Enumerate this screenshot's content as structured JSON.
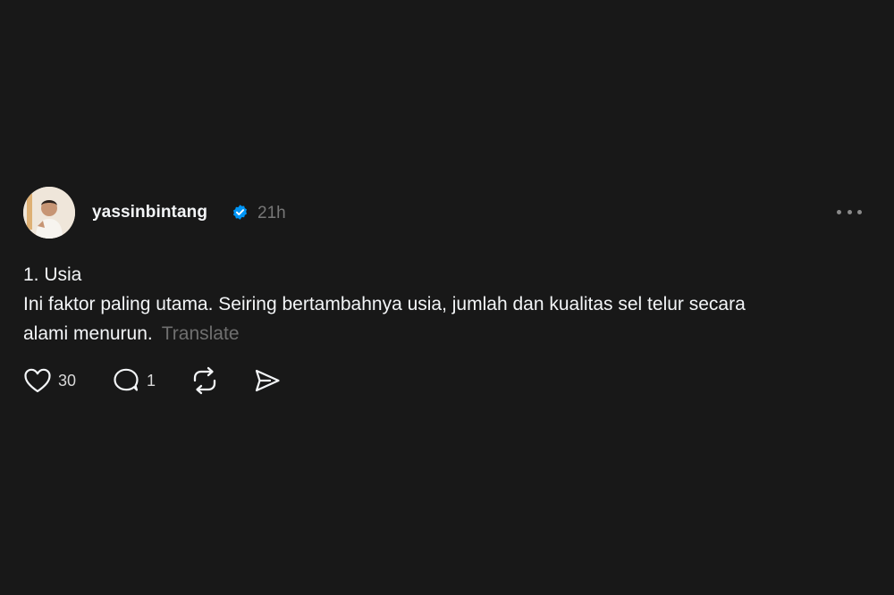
{
  "post": {
    "username": "yassinbintang",
    "verified": true,
    "time": "21h",
    "lines": [
      "1. Usia",
      "Ini faktor paling utama. Seiring bertambahnya usia, jumlah dan kualitas sel telur secara",
      "alami menurun."
    ],
    "translate_label": "Translate",
    "actions": {
      "like_count": "30",
      "reply_count": "1"
    }
  },
  "colors": {
    "background": "#181818",
    "text": "#f3f5f7",
    "muted": "#777777",
    "verified_blue": "#0095f6"
  },
  "icons": [
    "more-icon",
    "verified-icon",
    "heart-icon",
    "comment-icon",
    "repost-icon",
    "share-icon"
  ]
}
